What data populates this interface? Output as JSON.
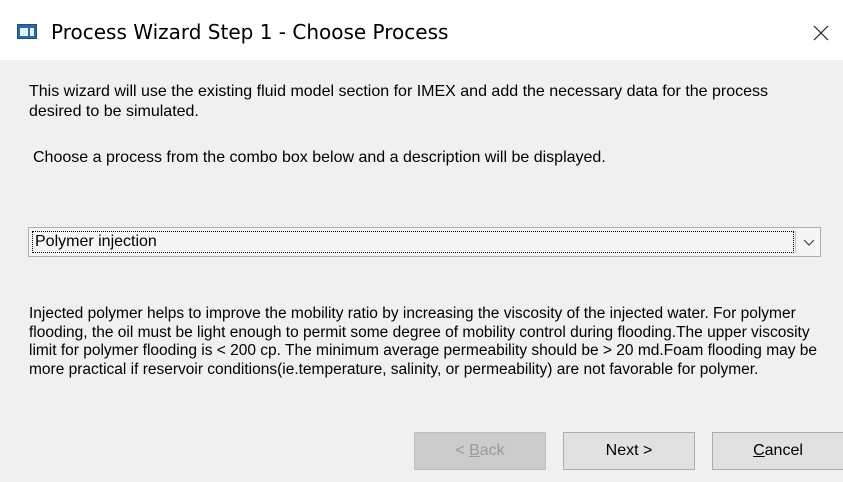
{
  "window": {
    "title": "Process Wizard Step 1 - Choose Process",
    "app_icon": "wizard-window-icon",
    "close_icon": "close-icon"
  },
  "intro_text": "This wizard will use the existing fluid model section for IMEX and add the necessary data for the process desired to be simulated.",
  "instruction_text": "Choose a process from the combo box below and a description will be displayed.",
  "process_combo": {
    "selected": "Polymer injection",
    "arrow_icon": "chevron-down-icon"
  },
  "description_text": "Injected polymer helps to improve the mobility ratio by increasing the viscosity of the injected water. For polymer flooding, the oil must be light enough to permit some degree of mobility control during flooding.The upper viscosity limit for polymer flooding is < 200 cp. The minimum average permeability should be > 20 md.Foam flooding may be more practical if reservoir conditions(ie.temperature, salinity, or permeability) are not favorable for polymer.",
  "buttons": {
    "back": {
      "prefix": "< ",
      "mnemonic": "B",
      "rest": "ack",
      "enabled": false
    },
    "next": {
      "label": "Next >",
      "enabled": true
    },
    "cancel": {
      "mnemonic": "C",
      "rest": "ancel",
      "enabled": true
    }
  }
}
